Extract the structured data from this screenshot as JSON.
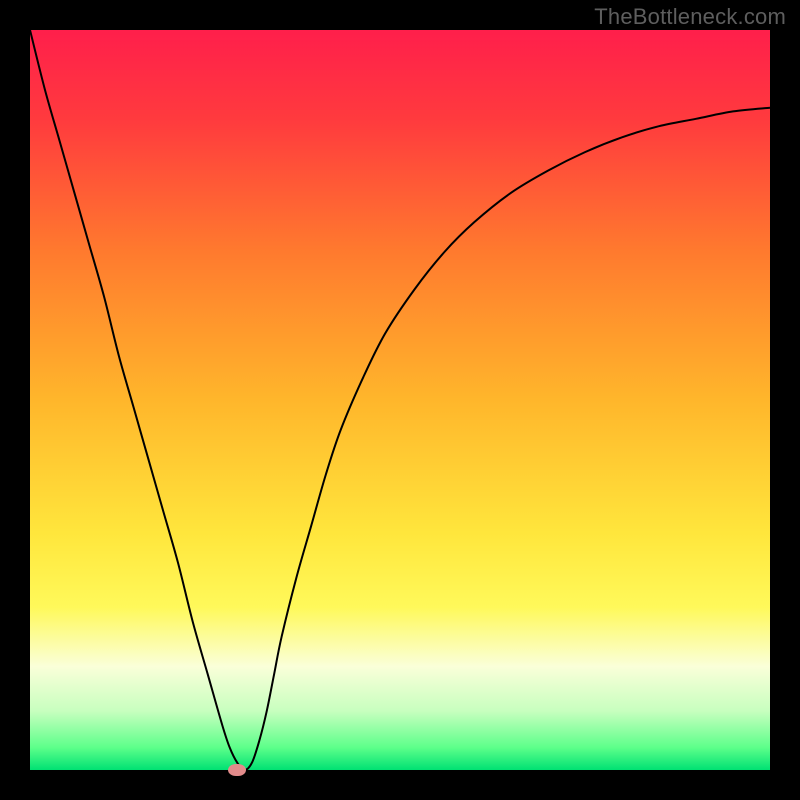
{
  "watermark": {
    "text": "TheBottleneck.com"
  },
  "chart_data": {
    "type": "line",
    "title": "",
    "xlabel": "",
    "ylabel": "",
    "xlim": [
      0,
      100
    ],
    "ylim": [
      0,
      100
    ],
    "grid": false,
    "background_gradient": {
      "stops": [
        {
          "offset": 0.0,
          "color": "#ff1f4b"
        },
        {
          "offset": 0.12,
          "color": "#ff3a3e"
        },
        {
          "offset": 0.3,
          "color": "#ff7a2e"
        },
        {
          "offset": 0.5,
          "color": "#ffb62b"
        },
        {
          "offset": 0.68,
          "color": "#ffe63c"
        },
        {
          "offset": 0.78,
          "color": "#fff95a"
        },
        {
          "offset": 0.86,
          "color": "#faffd9"
        },
        {
          "offset": 0.92,
          "color": "#c8ffbf"
        },
        {
          "offset": 0.97,
          "color": "#5cff8a"
        },
        {
          "offset": 1.0,
          "color": "#00e173"
        }
      ]
    },
    "series": [
      {
        "name": "bottleneck-curve",
        "color": "#000000",
        "width": 2,
        "x": [
          0,
          2,
          4,
          6,
          8,
          10,
          12,
          14,
          16,
          18,
          20,
          22,
          24,
          26,
          27,
          28,
          29,
          30,
          31,
          32,
          33,
          34,
          36,
          38,
          40,
          42,
          45,
          48,
          52,
          56,
          60,
          65,
          70,
          75,
          80,
          85,
          90,
          95,
          100
        ],
        "values": [
          100,
          92,
          85,
          78,
          71,
          64,
          56,
          49,
          42,
          35,
          28,
          20,
          13,
          6,
          3,
          1,
          0,
          1,
          4,
          8,
          13,
          18,
          26,
          33,
          40,
          46,
          53,
          59,
          65,
          70,
          74,
          78,
          81,
          83.5,
          85.5,
          87,
          88,
          89,
          89.5
        ]
      }
    ],
    "marker": {
      "x": 28,
      "y": 0,
      "color": "#e28b8b"
    }
  }
}
